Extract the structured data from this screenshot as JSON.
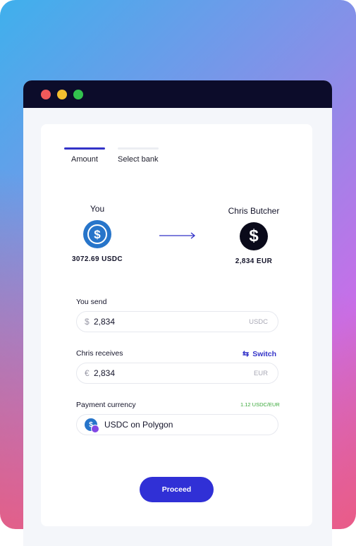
{
  "steps": [
    {
      "label": "Amount",
      "active": true
    },
    {
      "label": "Select bank",
      "active": false
    }
  ],
  "sender": {
    "name": "You",
    "amount": "3072.69 USDC",
    "icon": "usdc-coin-icon"
  },
  "recipient": {
    "name": "Chris Butcher",
    "amount": "2,834 EUR",
    "icon": "dollar-coin-icon"
  },
  "send": {
    "label": "You send",
    "prefix": "$",
    "value": "2,834",
    "unit": "USDC"
  },
  "receive": {
    "label": "Chris receives",
    "prefix": "€",
    "value": "2,834",
    "unit": "EUR",
    "switch_label": "Switch",
    "switch_icon": "swap-icon"
  },
  "payment": {
    "label": "Payment currency",
    "rate": "1.12 USDC/EUR",
    "currency": "USDC on Polygon",
    "icon": "usdc-polygon-icon"
  },
  "proceed_label": "Proceed",
  "colors": {
    "accent": "#3030d6",
    "rate": "#3aa83a",
    "titlebar": "#0c0c2a"
  }
}
